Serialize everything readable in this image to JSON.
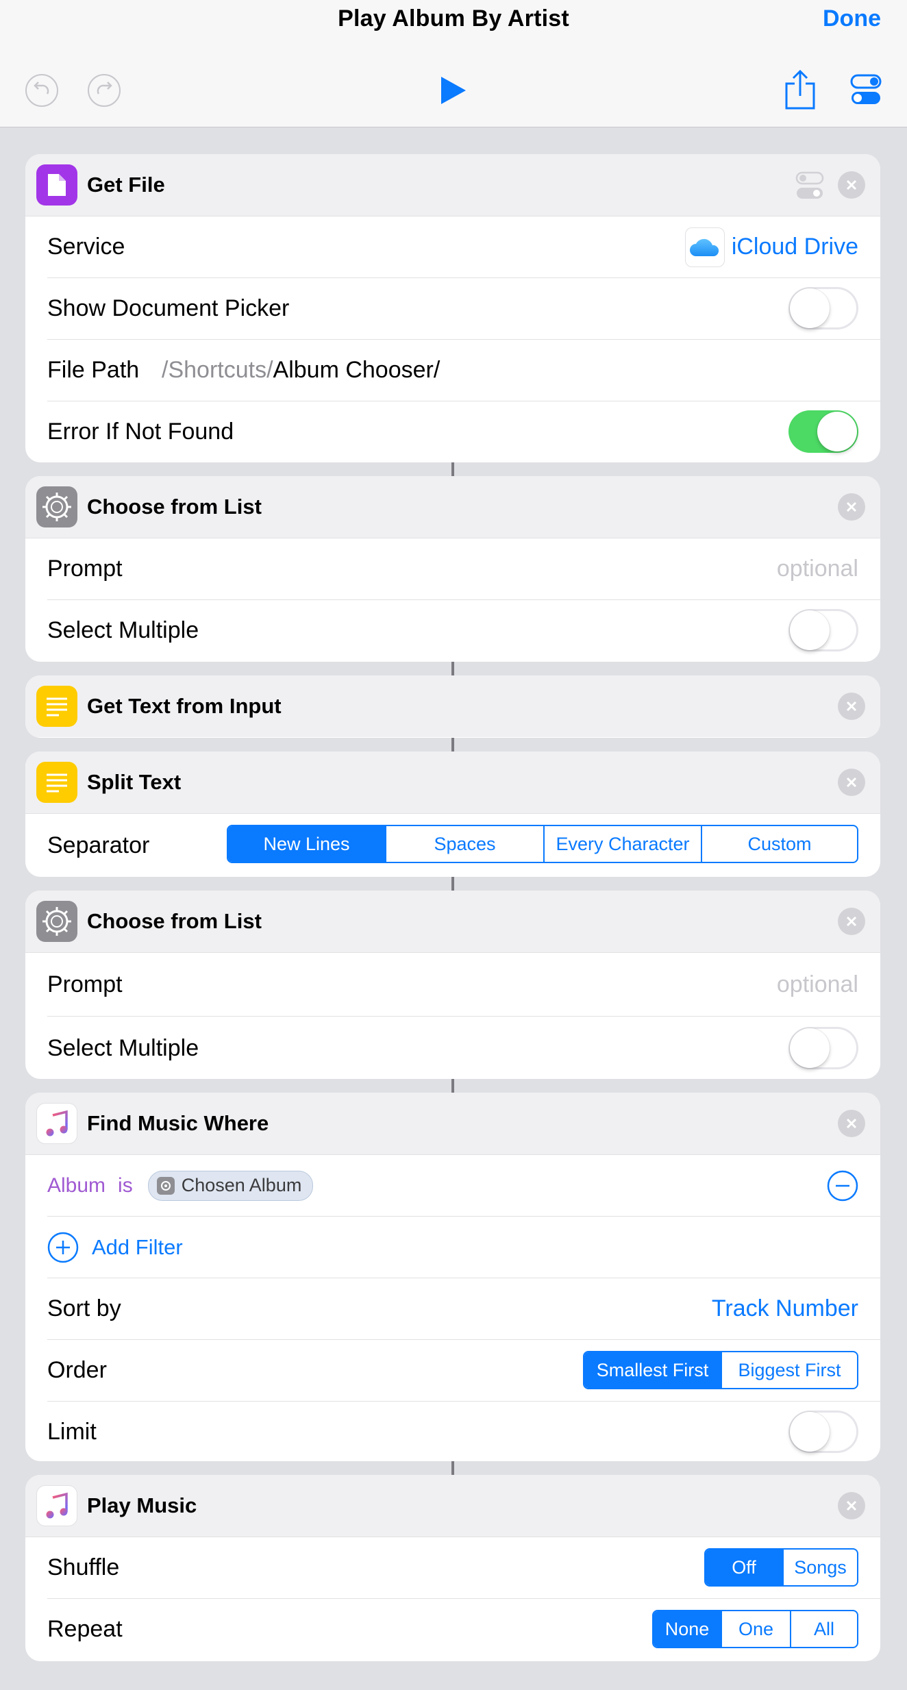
{
  "header": {
    "title": "Play Album By Artist",
    "done_label": "Done"
  },
  "actions": {
    "get_file": {
      "title": "Get File",
      "service_label": "Service",
      "service_value": "iCloud Drive",
      "show_picker_label": "Show Document Picker",
      "show_picker_on": false,
      "file_path_label": "File Path",
      "file_path_prefix": "/Shortcuts/",
      "file_path_value": "Album Chooser/",
      "error_label": "Error If Not Found",
      "error_on": true
    },
    "choose_list_1": {
      "title": "Choose from List",
      "prompt_label": "Prompt",
      "prompt_placeholder": "optional",
      "multiple_label": "Select Multiple",
      "multiple_on": false
    },
    "get_text": {
      "title": "Get Text from Input"
    },
    "split_text": {
      "title": "Split Text",
      "separator_label": "Separator",
      "options": [
        "New Lines",
        "Spaces",
        "Every Character",
        "Custom"
      ],
      "selected": "New Lines"
    },
    "choose_list_2": {
      "title": "Choose from List",
      "prompt_label": "Prompt",
      "prompt_placeholder": "optional",
      "multiple_label": "Select Multiple",
      "multiple_on": false
    },
    "find_music": {
      "title": "Find Music Where",
      "filter_field": "Album",
      "filter_op": "is",
      "filter_value": "Chosen Album",
      "add_filter_label": "Add Filter",
      "sort_label": "Sort by",
      "sort_value": "Track Number",
      "order_label": "Order",
      "order_options": [
        "Smallest First",
        "Biggest First"
      ],
      "order_selected": "Smallest First",
      "limit_label": "Limit",
      "limit_on": false
    },
    "play_music": {
      "title": "Play Music",
      "shuffle_label": "Shuffle",
      "shuffle_options": [
        "Off",
        "Songs"
      ],
      "shuffle_selected": "Off",
      "repeat_label": "Repeat",
      "repeat_options": [
        "None",
        "One",
        "All"
      ],
      "repeat_selected": "None"
    }
  },
  "colors": {
    "accent": "#0a7aff",
    "toggle_on": "#4cd964",
    "filter_purple": "#a05ad2",
    "get_file_icon": "#a235e8",
    "text_icon": "#ffcc00",
    "list_icon": "#8e8e93"
  }
}
